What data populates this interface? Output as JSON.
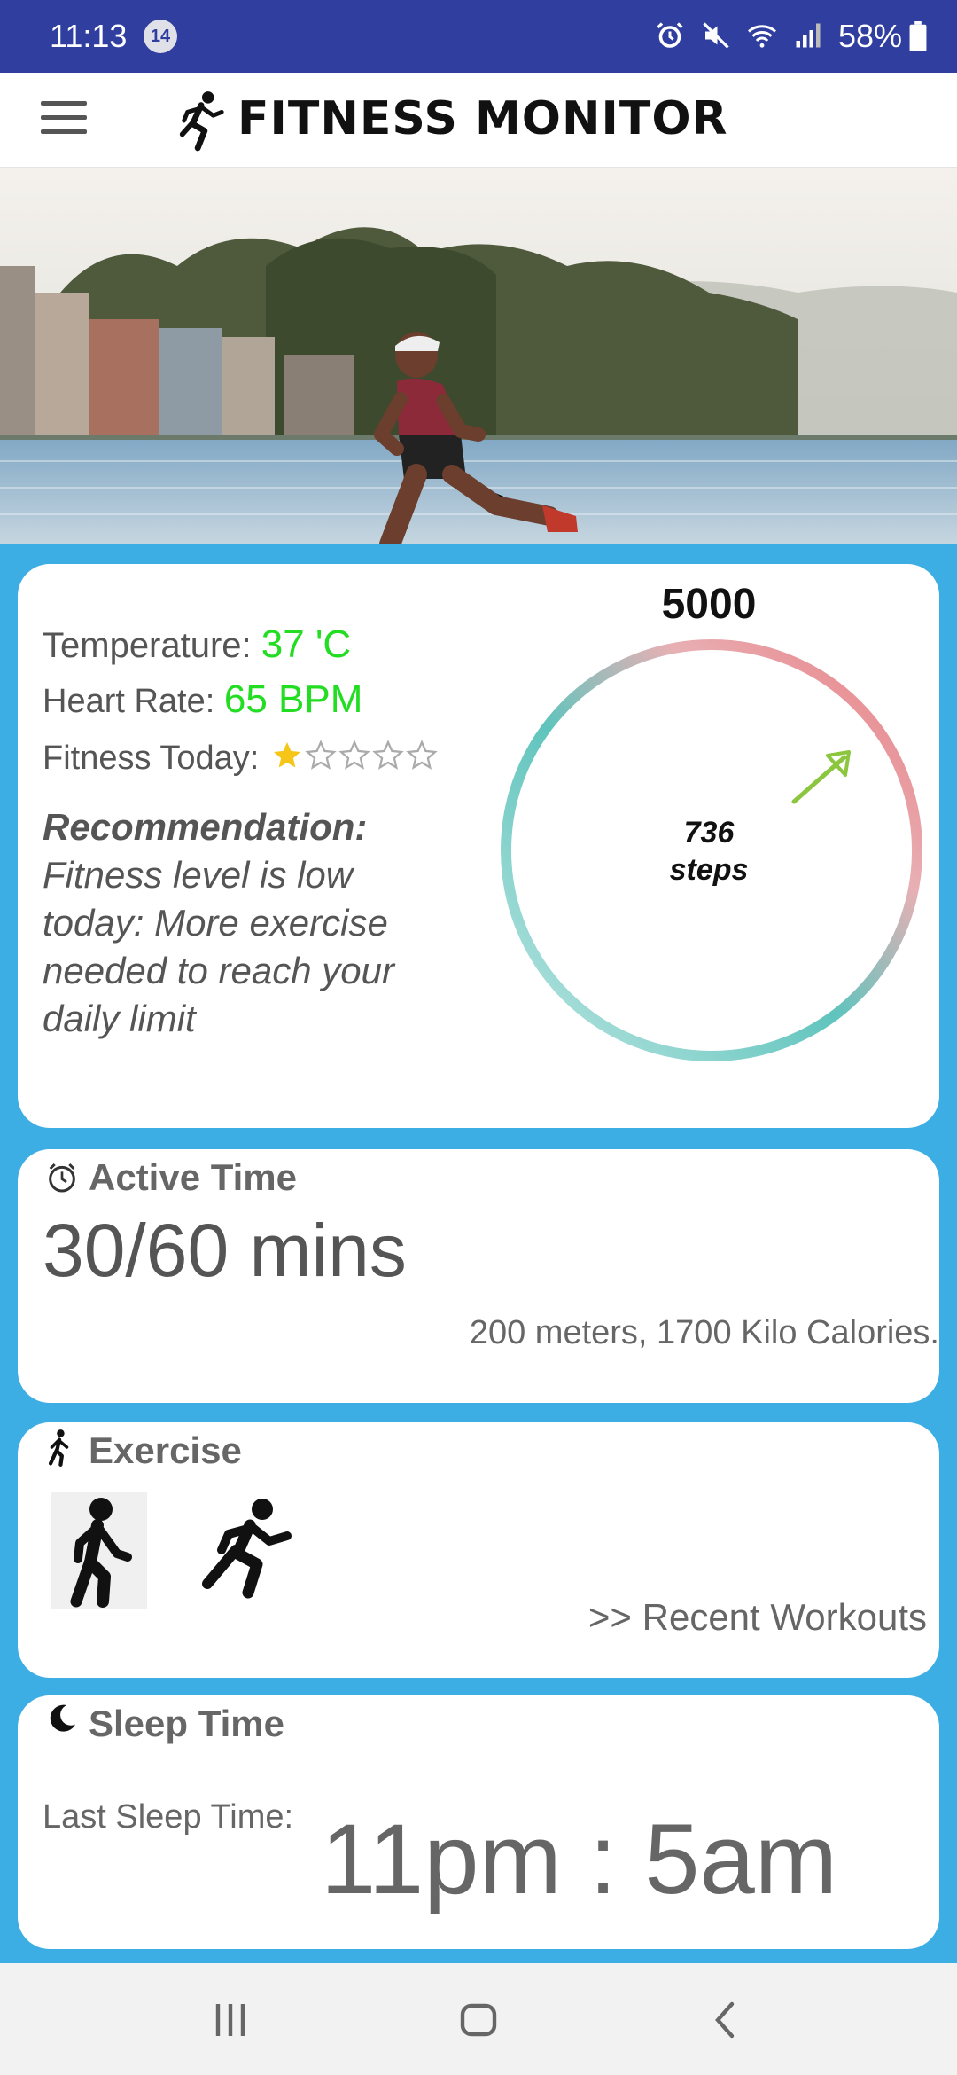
{
  "status_bar": {
    "time": "11:13",
    "notification_count": "14",
    "battery": "58%",
    "icons": [
      "alarm-icon",
      "mute-icon",
      "wifi-icon",
      "signal-icon",
      "battery-icon"
    ]
  },
  "app_bar": {
    "title": "FITNESS MONITOR",
    "menu_icon": "hamburger-menu-icon",
    "logo_icon": "runner-icon"
  },
  "hero": {
    "icon": "runner-by-water-photo"
  },
  "summary": {
    "temperature_label": "Temperature:",
    "temperature_value": "37 'C",
    "heart_rate_label": "Heart Rate:",
    "heart_rate_value": "65 BPM",
    "fitness_label": "Fitness Today:",
    "fitness_rating": 1,
    "fitness_max": 5,
    "recommendation_title": "Recommendation:",
    "recommendation_text": "Fitness level is low today: More exercise needed to reach your daily limit",
    "goal_steps": "5000",
    "steps_count": "736",
    "steps_unit": "steps",
    "steps_progress": 0.1472,
    "colors": {
      "value_green": "#22dd22",
      "ring_teal": "#5fc4bd",
      "ring_red": "#e87b80",
      "arrow_green": "#8cc63f"
    }
  },
  "active_time": {
    "title": "Active Time",
    "icon": "alarm-clock-icon",
    "value": "30/60 mins",
    "details": "200 meters, 1700 Kilo Calories."
  },
  "exercise": {
    "title": "Exercise",
    "icon": "walking-person-icon",
    "options": [
      "walking-icon",
      "running-icon"
    ],
    "recent_link": ">> Recent Workouts"
  },
  "sleep": {
    "title": "Sleep Time",
    "icon": "crescent-moon-icon",
    "label": "Last Sleep Time:",
    "value": "11pm : 5am"
  },
  "nav_bar": {
    "buttons": [
      "recent-apps-icon",
      "home-icon",
      "back-icon"
    ]
  },
  "theme": {
    "status_bar_bg": "#303f9f",
    "content_bg": "#3daee3",
    "card_bg": "#ffffff"
  }
}
